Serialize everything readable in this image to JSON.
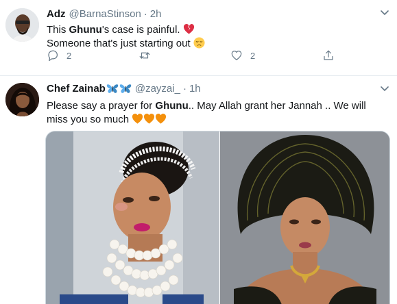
{
  "tweets": [
    {
      "name": "Adz",
      "handle": "@BarnaStinson",
      "separator": "·",
      "time": "2h",
      "text_line1_pre": "This ",
      "text_line1_bold": "Ghunu",
      "text_line1_post": "'s case is painful.",
      "text_line2": "Someone that's just starting out",
      "reply_count": "2",
      "retweet_count": "",
      "like_count": "2"
    },
    {
      "name": "Chef Zainab",
      "handle": "@zayzai_",
      "separator": "·",
      "time": "1h",
      "text_pre": "Please say a prayer for ",
      "text_bold": "Ghunu",
      "text_post": ".. May Allah grant her Jannah .. We will miss you so much"
    }
  ],
  "icons": {
    "broken_heart": "broken-heart-emoji",
    "pensive": "pensive-face-emoji",
    "orange_heart": "orange-heart-emoji",
    "butterfly": "butterfly-emoji",
    "reply": "reply-icon",
    "retweet": "retweet-icon",
    "like": "like-icon",
    "share": "share-icon",
    "caret": "chevron-down-icon"
  },
  "colors": {
    "text": "#14171a",
    "muted": "#657786",
    "divider": "#e6ecf0",
    "broken_heart": "#dd2e44",
    "orange_heart": "#f4900c",
    "butterfly": "#5dadec"
  }
}
